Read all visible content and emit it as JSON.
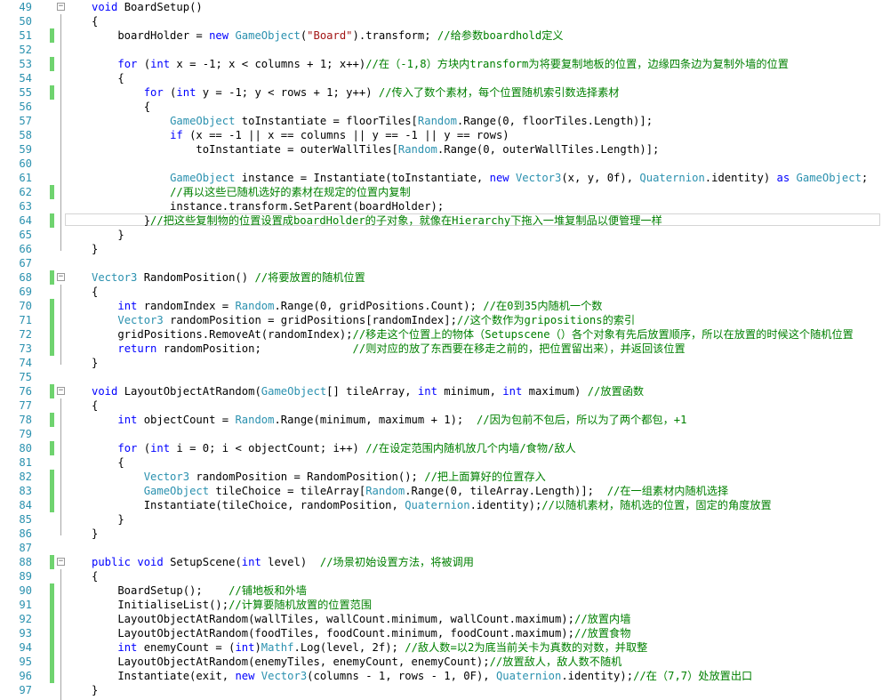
{
  "colors": {
    "keyword": "#0000ff",
    "type": "#2b91af",
    "string": "#a31515",
    "comment": "#008000",
    "line_number": "#2b91af",
    "change_marker": "#6fd36f"
  },
  "lines": [
    {
      "n": "49",
      "fold": "−",
      "segs": [
        {
          "t": "void",
          "c": "kw"
        },
        {
          "t": " BoardSetup()"
        }
      ]
    },
    {
      "n": "50",
      "segs": [
        {
          "t": "{"
        }
      ]
    },
    {
      "n": "51",
      "mark": true,
      "segs": [
        {
          "t": "    boardHolder = "
        },
        {
          "t": "new",
          "c": "kw"
        },
        {
          "t": " "
        },
        {
          "t": "GameObject",
          "c": "ty"
        },
        {
          "t": "("
        },
        {
          "t": "\"Board\"",
          "c": "str"
        },
        {
          "t": ").transform; "
        },
        {
          "t": "//给参数boardhold定义",
          "c": "cm"
        }
      ]
    },
    {
      "n": "52",
      "segs": []
    },
    {
      "n": "53",
      "mark": true,
      "segs": [
        {
          "t": "    "
        },
        {
          "t": "for",
          "c": "kw"
        },
        {
          "t": " ("
        },
        {
          "t": "int",
          "c": "kw"
        },
        {
          "t": " x = -1; x < columns + 1; x++)"
        },
        {
          "t": "//在（-1,8）方块内transform为将要复制地板的位置，边缘四条边为复制外墙的位置",
          "c": "cm"
        }
      ]
    },
    {
      "n": "54",
      "segs": [
        {
          "t": "    {"
        }
      ]
    },
    {
      "n": "55",
      "mark": true,
      "segs": [
        {
          "t": "        "
        },
        {
          "t": "for",
          "c": "kw"
        },
        {
          "t": " ("
        },
        {
          "t": "int",
          "c": "kw"
        },
        {
          "t": " y = -1; y < rows + 1; y++) "
        },
        {
          "t": "//传入了数个素材，每个位置随机索引数选择素材",
          "c": "cm"
        }
      ]
    },
    {
      "n": "56",
      "segs": [
        {
          "t": "        {"
        }
      ]
    },
    {
      "n": "57",
      "segs": [
        {
          "t": "            "
        },
        {
          "t": "GameObject",
          "c": "ty"
        },
        {
          "t": " toInstantiate = floorTiles["
        },
        {
          "t": "Random",
          "c": "ty"
        },
        {
          "t": ".Range(0, floorTiles.Length)];"
        }
      ]
    },
    {
      "n": "58",
      "segs": [
        {
          "t": "            "
        },
        {
          "t": "if",
          "c": "kw"
        },
        {
          "t": " (x == -1 || x == columns || y == -1 || y == rows)"
        }
      ]
    },
    {
      "n": "59",
      "segs": [
        {
          "t": "                toInstantiate = outerWallTiles["
        },
        {
          "t": "Random",
          "c": "ty"
        },
        {
          "t": ".Range(0, outerWallTiles.Length)];"
        }
      ]
    },
    {
      "n": "60",
      "segs": []
    },
    {
      "n": "61",
      "segs": [
        {
          "t": "            "
        },
        {
          "t": "GameObject",
          "c": "ty"
        },
        {
          "t": " instance = Instantiate(toInstantiate, "
        },
        {
          "t": "new",
          "c": "kw"
        },
        {
          "t": " "
        },
        {
          "t": "Vector3",
          "c": "ty"
        },
        {
          "t": "(x, y, 0f), "
        },
        {
          "t": "Quaternion",
          "c": "ty"
        },
        {
          "t": ".identity) "
        },
        {
          "t": "as",
          "c": "kw"
        },
        {
          "t": " "
        },
        {
          "t": "GameObject",
          "c": "ty"
        },
        {
          "t": ";"
        }
      ]
    },
    {
      "n": "62",
      "mark": true,
      "segs": [
        {
          "t": "            "
        },
        {
          "t": "//再以这些已随机选好的素材在规定的位置内复制",
          "c": "cm"
        }
      ]
    },
    {
      "n": "63",
      "segs": [
        {
          "t": "            instance.transform.SetParent(boardHolder);"
        }
      ]
    },
    {
      "n": "64",
      "mark": true,
      "hl": true,
      "segs": [
        {
          "t": "        }"
        },
        {
          "t": "//把这些复制物的位置设置成boardHolder的子对象，就像在Hierarchy下拖入一堆复制品以便管理一样",
          "c": "cm"
        }
      ]
    },
    {
      "n": "65",
      "segs": [
        {
          "t": "    }"
        }
      ]
    },
    {
      "n": "66",
      "segs": [
        {
          "t": "}"
        }
      ]
    },
    {
      "n": "67",
      "segs": []
    },
    {
      "n": "68",
      "fold": "−",
      "mark": true,
      "segs": [
        {
          "t": "Vector3",
          "c": "ty"
        },
        {
          "t": " RandomPosition() "
        },
        {
          "t": "//将要放置的随机位置",
          "c": "cm"
        }
      ]
    },
    {
      "n": "69",
      "segs": [
        {
          "t": "{"
        }
      ]
    },
    {
      "n": "70",
      "mark": true,
      "segs": [
        {
          "t": "    "
        },
        {
          "t": "int",
          "c": "kw"
        },
        {
          "t": " randomIndex = "
        },
        {
          "t": "Random",
          "c": "ty"
        },
        {
          "t": ".Range(0, gridPositions.Count); "
        },
        {
          "t": "//在0到35内随机一个数",
          "c": "cm"
        }
      ]
    },
    {
      "n": "71",
      "mark": true,
      "segs": [
        {
          "t": "    "
        },
        {
          "t": "Vector3",
          "c": "ty"
        },
        {
          "t": " randomPosition = gridPositions[randomIndex];"
        },
        {
          "t": "//这个数作为gripositions的索引",
          "c": "cm"
        }
      ]
    },
    {
      "n": "72",
      "mark": true,
      "segs": [
        {
          "t": "    gridPositions.RemoveAt(randomIndex);"
        },
        {
          "t": "//移走这个位置上的物体（Setupscene（）各个对象有先后放置顺序，所以在放置的时候这个随机位置",
          "c": "cm"
        }
      ]
    },
    {
      "n": "73",
      "mark": true,
      "segs": [
        {
          "t": "    "
        },
        {
          "t": "return",
          "c": "kw"
        },
        {
          "t": " randomPosition;              "
        },
        {
          "t": "//则对应的放了东西要在移走之前的，把位置留出来），并返回该位置",
          "c": "cm"
        }
      ]
    },
    {
      "n": "74",
      "segs": [
        {
          "t": "}"
        }
      ]
    },
    {
      "n": "75",
      "segs": []
    },
    {
      "n": "76",
      "fold": "−",
      "mark": true,
      "segs": [
        {
          "t": "void",
          "c": "kw"
        },
        {
          "t": " LayoutObjectAtRandom("
        },
        {
          "t": "GameObject",
          "c": "ty"
        },
        {
          "t": "[] tileArray, "
        },
        {
          "t": "int",
          "c": "kw"
        },
        {
          "t": " minimum, "
        },
        {
          "t": "int",
          "c": "kw"
        },
        {
          "t": " maximum) "
        },
        {
          "t": "//放置函数",
          "c": "cm"
        }
      ]
    },
    {
      "n": "77",
      "segs": [
        {
          "t": "{"
        }
      ]
    },
    {
      "n": "78",
      "mark": true,
      "segs": [
        {
          "t": "    "
        },
        {
          "t": "int",
          "c": "kw"
        },
        {
          "t": " objectCount = "
        },
        {
          "t": "Random",
          "c": "ty"
        },
        {
          "t": ".Range(minimum, maximum + 1);  "
        },
        {
          "t": "//因为包前不包后，所以为了两个都包，+1",
          "c": "cm"
        }
      ]
    },
    {
      "n": "79",
      "segs": []
    },
    {
      "n": "80",
      "mark": true,
      "segs": [
        {
          "t": "    "
        },
        {
          "t": "for",
          "c": "kw"
        },
        {
          "t": " ("
        },
        {
          "t": "int",
          "c": "kw"
        },
        {
          "t": " i = 0; i < objectCount; i++) "
        },
        {
          "t": "//在设定范围内随机放几个内墙/食物/敌人",
          "c": "cm"
        }
      ]
    },
    {
      "n": "81",
      "segs": [
        {
          "t": "    {"
        }
      ]
    },
    {
      "n": "82",
      "mark": true,
      "segs": [
        {
          "t": "        "
        },
        {
          "t": "Vector3",
          "c": "ty"
        },
        {
          "t": " randomPosition = RandomPosition(); "
        },
        {
          "t": "//把上面算好的位置存入",
          "c": "cm"
        }
      ]
    },
    {
      "n": "83",
      "mark": true,
      "segs": [
        {
          "t": "        "
        },
        {
          "t": "GameObject",
          "c": "ty"
        },
        {
          "t": " tileChoice = tileArray["
        },
        {
          "t": "Random",
          "c": "ty"
        },
        {
          "t": ".Range(0, tileArray.Length)];  "
        },
        {
          "t": "//在一组素材内随机选择",
          "c": "cm"
        }
      ]
    },
    {
      "n": "84",
      "mark": true,
      "segs": [
        {
          "t": "        Instantiate(tileChoice, randomPosition, "
        },
        {
          "t": "Quaternion",
          "c": "ty"
        },
        {
          "t": ".identity);"
        },
        {
          "t": "//以随机素材，随机选的位置，固定的角度放置",
          "c": "cm"
        }
      ]
    },
    {
      "n": "85",
      "segs": [
        {
          "t": "    }"
        }
      ]
    },
    {
      "n": "86",
      "segs": [
        {
          "t": "}"
        }
      ]
    },
    {
      "n": "87",
      "segs": []
    },
    {
      "n": "88",
      "fold": "−",
      "mark": true,
      "segs": [
        {
          "t": "public",
          "c": "kw"
        },
        {
          "t": " "
        },
        {
          "t": "void",
          "c": "kw"
        },
        {
          "t": " SetupScene("
        },
        {
          "t": "int",
          "c": "kw"
        },
        {
          "t": " level)  "
        },
        {
          "t": "//场景初始设置方法，将被调用",
          "c": "cm"
        }
      ]
    },
    {
      "n": "89",
      "segs": [
        {
          "t": "{"
        }
      ]
    },
    {
      "n": "90",
      "mark": true,
      "segs": [
        {
          "t": "    BoardSetup();    "
        },
        {
          "t": "//铺地板和外墙",
          "c": "cm"
        }
      ]
    },
    {
      "n": "91",
      "mark": true,
      "segs": [
        {
          "t": "    InitialiseList();"
        },
        {
          "t": "//计算要随机放置的位置范围",
          "c": "cm"
        }
      ]
    },
    {
      "n": "92",
      "mark": true,
      "segs": [
        {
          "t": "    LayoutObjectAtRandom(wallTiles, wallCount.minimum, wallCount.maximum);"
        },
        {
          "t": "//放置内墙",
          "c": "cm"
        }
      ]
    },
    {
      "n": "93",
      "mark": true,
      "segs": [
        {
          "t": "    LayoutObjectAtRandom(foodTiles, foodCount.minimum, foodCount.maximum);"
        },
        {
          "t": "//放置食物",
          "c": "cm"
        }
      ]
    },
    {
      "n": "94",
      "mark": true,
      "segs": [
        {
          "t": "    "
        },
        {
          "t": "int",
          "c": "kw"
        },
        {
          "t": " enemyCount = ("
        },
        {
          "t": "int",
          "c": "kw"
        },
        {
          "t": ")"
        },
        {
          "t": "Mathf",
          "c": "ty"
        },
        {
          "t": ".Log(level, 2f); "
        },
        {
          "t": "//敌人数=以2为底当前关卡为真数的对数，并取整",
          "c": "cm"
        }
      ]
    },
    {
      "n": "95",
      "mark": true,
      "segs": [
        {
          "t": "    LayoutObjectAtRandom(enemyTiles, enemyCount, enemyCount);"
        },
        {
          "t": "//放置敌人，敌人数不随机",
          "c": "cm"
        }
      ]
    },
    {
      "n": "96",
      "mark": true,
      "segs": [
        {
          "t": "    Instantiate(exit, "
        },
        {
          "t": "new",
          "c": "kw"
        },
        {
          "t": " "
        },
        {
          "t": "Vector3",
          "c": "ty"
        },
        {
          "t": "(columns - 1, rows - 1, 0F), "
        },
        {
          "t": "Quaternion",
          "c": "ty"
        },
        {
          "t": ".identity);"
        },
        {
          "t": "//在（7,7）处放置出口",
          "c": "cm"
        }
      ]
    },
    {
      "n": "97",
      "segs": [
        {
          "t": "}"
        }
      ]
    }
  ]
}
